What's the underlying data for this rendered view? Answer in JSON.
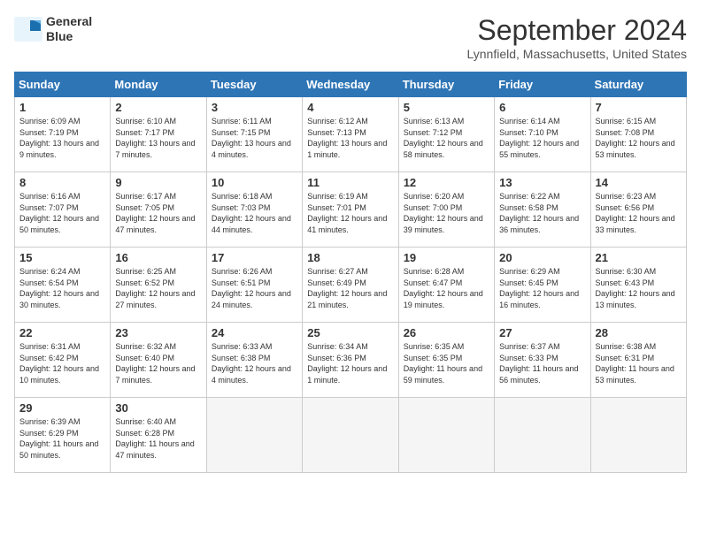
{
  "header": {
    "logo_line1": "General",
    "logo_line2": "Blue",
    "month": "September 2024",
    "location": "Lynnfield, Massachusetts, United States"
  },
  "weekdays": [
    "Sunday",
    "Monday",
    "Tuesday",
    "Wednesday",
    "Thursday",
    "Friday",
    "Saturday"
  ],
  "weeks": [
    [
      {
        "day": 1,
        "sunrise": "6:09 AM",
        "sunset": "7:19 PM",
        "daylight": "13 hours and 9 minutes."
      },
      {
        "day": 2,
        "sunrise": "6:10 AM",
        "sunset": "7:17 PM",
        "daylight": "13 hours and 7 minutes."
      },
      {
        "day": 3,
        "sunrise": "6:11 AM",
        "sunset": "7:15 PM",
        "daylight": "13 hours and 4 minutes."
      },
      {
        "day": 4,
        "sunrise": "6:12 AM",
        "sunset": "7:13 PM",
        "daylight": "13 hours and 1 minute."
      },
      {
        "day": 5,
        "sunrise": "6:13 AM",
        "sunset": "7:12 PM",
        "daylight": "12 hours and 58 minutes."
      },
      {
        "day": 6,
        "sunrise": "6:14 AM",
        "sunset": "7:10 PM",
        "daylight": "12 hours and 55 minutes."
      },
      {
        "day": 7,
        "sunrise": "6:15 AM",
        "sunset": "7:08 PM",
        "daylight": "12 hours and 53 minutes."
      }
    ],
    [
      {
        "day": 8,
        "sunrise": "6:16 AM",
        "sunset": "7:07 PM",
        "daylight": "12 hours and 50 minutes."
      },
      {
        "day": 9,
        "sunrise": "6:17 AM",
        "sunset": "7:05 PM",
        "daylight": "12 hours and 47 minutes."
      },
      {
        "day": 10,
        "sunrise": "6:18 AM",
        "sunset": "7:03 PM",
        "daylight": "12 hours and 44 minutes."
      },
      {
        "day": 11,
        "sunrise": "6:19 AM",
        "sunset": "7:01 PM",
        "daylight": "12 hours and 41 minutes."
      },
      {
        "day": 12,
        "sunrise": "6:20 AM",
        "sunset": "7:00 PM",
        "daylight": "12 hours and 39 minutes."
      },
      {
        "day": 13,
        "sunrise": "6:22 AM",
        "sunset": "6:58 PM",
        "daylight": "12 hours and 36 minutes."
      },
      {
        "day": 14,
        "sunrise": "6:23 AM",
        "sunset": "6:56 PM",
        "daylight": "12 hours and 33 minutes."
      }
    ],
    [
      {
        "day": 15,
        "sunrise": "6:24 AM",
        "sunset": "6:54 PM",
        "daylight": "12 hours and 30 minutes."
      },
      {
        "day": 16,
        "sunrise": "6:25 AM",
        "sunset": "6:52 PM",
        "daylight": "12 hours and 27 minutes."
      },
      {
        "day": 17,
        "sunrise": "6:26 AM",
        "sunset": "6:51 PM",
        "daylight": "12 hours and 24 minutes."
      },
      {
        "day": 18,
        "sunrise": "6:27 AM",
        "sunset": "6:49 PM",
        "daylight": "12 hours and 21 minutes."
      },
      {
        "day": 19,
        "sunrise": "6:28 AM",
        "sunset": "6:47 PM",
        "daylight": "12 hours and 19 minutes."
      },
      {
        "day": 20,
        "sunrise": "6:29 AM",
        "sunset": "6:45 PM",
        "daylight": "12 hours and 16 minutes."
      },
      {
        "day": 21,
        "sunrise": "6:30 AM",
        "sunset": "6:43 PM",
        "daylight": "12 hours and 13 minutes."
      }
    ],
    [
      {
        "day": 22,
        "sunrise": "6:31 AM",
        "sunset": "6:42 PM",
        "daylight": "12 hours and 10 minutes."
      },
      {
        "day": 23,
        "sunrise": "6:32 AM",
        "sunset": "6:40 PM",
        "daylight": "12 hours and 7 minutes."
      },
      {
        "day": 24,
        "sunrise": "6:33 AM",
        "sunset": "6:38 PM",
        "daylight": "12 hours and 4 minutes."
      },
      {
        "day": 25,
        "sunrise": "6:34 AM",
        "sunset": "6:36 PM",
        "daylight": "12 hours and 1 minute."
      },
      {
        "day": 26,
        "sunrise": "6:35 AM",
        "sunset": "6:35 PM",
        "daylight": "11 hours and 59 minutes."
      },
      {
        "day": 27,
        "sunrise": "6:37 AM",
        "sunset": "6:33 PM",
        "daylight": "11 hours and 56 minutes."
      },
      {
        "day": 28,
        "sunrise": "6:38 AM",
        "sunset": "6:31 PM",
        "daylight": "11 hours and 53 minutes."
      }
    ],
    [
      {
        "day": 29,
        "sunrise": "6:39 AM",
        "sunset": "6:29 PM",
        "daylight": "11 hours and 50 minutes."
      },
      {
        "day": 30,
        "sunrise": "6:40 AM",
        "sunset": "6:28 PM",
        "daylight": "11 hours and 47 minutes."
      },
      null,
      null,
      null,
      null,
      null
    ]
  ]
}
